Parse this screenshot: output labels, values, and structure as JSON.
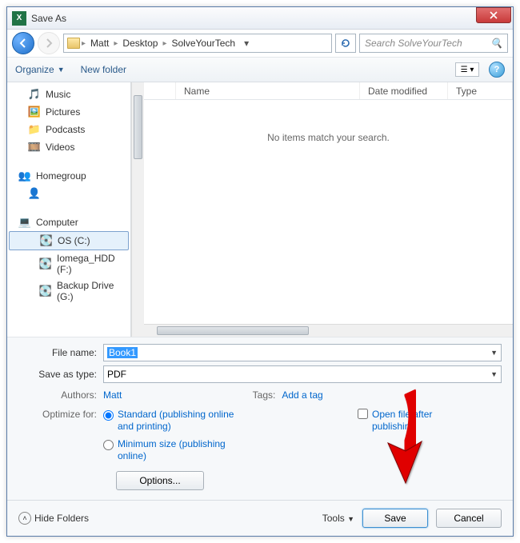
{
  "title": "Save As",
  "breadcrumbs": [
    "Matt",
    "Desktop",
    "SolveYourTech"
  ],
  "search_placeholder": "Search SolveYourTech",
  "toolbar": {
    "organize": "Organize",
    "newfolder": "New folder"
  },
  "tree": {
    "music": "Music",
    "pictures": "Pictures",
    "podcasts": "Podcasts",
    "videos": "Videos",
    "homegroup": "Homegroup",
    "computer": "Computer",
    "os": "OS (C:)",
    "iomega": "Iomega_HDD (F:)",
    "backup": "Backup Drive (G:)"
  },
  "columns": {
    "name": "Name",
    "date": "Date modified",
    "type": "Type"
  },
  "empty_msg": "No items match your search.",
  "filename_label": "File name:",
  "filename_value": "Book1",
  "savetype_label": "Save as type:",
  "savetype_value": "PDF",
  "authors_label": "Authors:",
  "authors_value": "Matt",
  "tags_label": "Tags:",
  "tags_value": "Add a tag",
  "optimize_label": "Optimize for:",
  "opt_standard": "Standard (publishing online and printing)",
  "opt_min": "Minimum size (publishing online)",
  "open_after": "Open file after publishing",
  "options_btn": "Options...",
  "hide_folders": "Hide Folders",
  "tools": "Tools",
  "save": "Save",
  "cancel": "Cancel"
}
